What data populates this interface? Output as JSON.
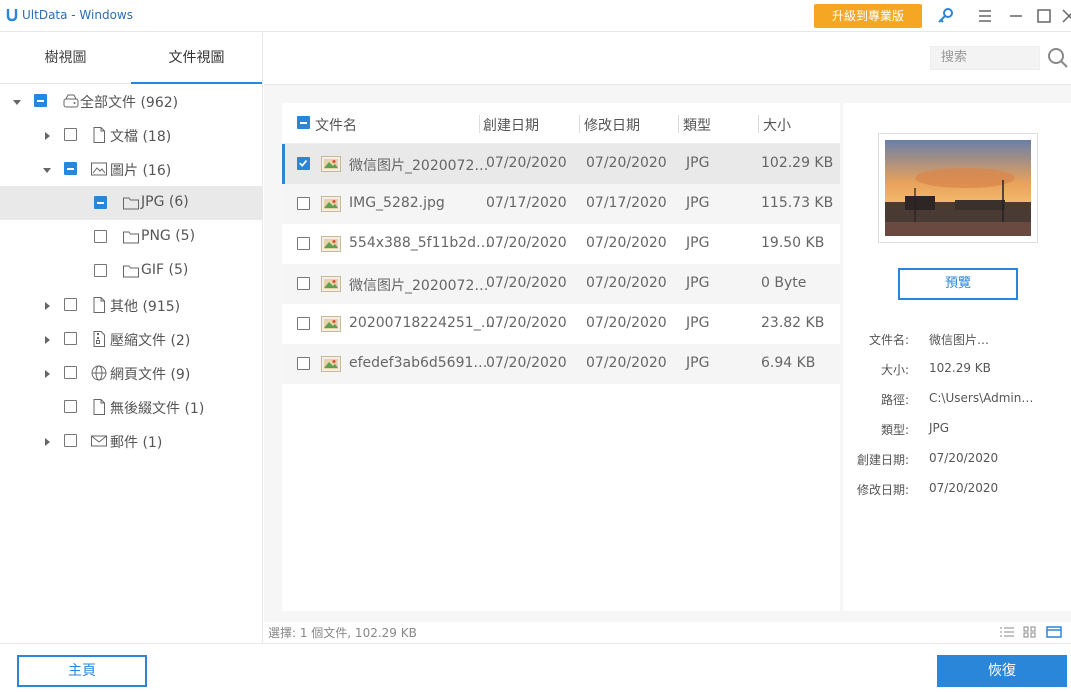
{
  "window": {
    "title": "UltData - Windows",
    "upgrade_label": "升級到專業版"
  },
  "colors": {
    "accent": "#2a86d8",
    "upgrade": "#f5a623"
  },
  "tabs": [
    {
      "label": "樹視圖",
      "active": false
    },
    {
      "label": "文件視圖",
      "active": true
    }
  ],
  "tree": [
    {
      "label": "全部文件 (962)",
      "icon": "drive-icon",
      "state": "partial",
      "expand": "open"
    },
    {
      "label": "文檔 (18)",
      "icon": "document-icon",
      "state": "unchecked",
      "expand": "closed"
    },
    {
      "label": "圖片 (16)",
      "icon": "image-icon",
      "state": "partial",
      "expand": "open"
    },
    {
      "label": "JPG (6)",
      "icon": "folder-icon",
      "state": "partial",
      "expand": "none"
    },
    {
      "label": "PNG (5)",
      "icon": "folder-icon",
      "state": "unchecked",
      "expand": "none"
    },
    {
      "label": "GIF (5)",
      "icon": "folder-icon",
      "state": "unchecked",
      "expand": "none"
    },
    {
      "label": "其他 (915)",
      "icon": "document-icon",
      "state": "unchecked",
      "expand": "closed"
    },
    {
      "label": "壓縮文件 (2)",
      "icon": "archive-icon",
      "state": "unchecked",
      "expand": "closed"
    },
    {
      "label": "網頁文件 (9)",
      "icon": "globe-icon",
      "state": "unchecked",
      "expand": "closed"
    },
    {
      "label": "無後綴文件 (1)",
      "icon": "document-icon",
      "state": "unchecked",
      "expand": "none"
    },
    {
      "label": "郵件 (1)",
      "icon": "mail-icon",
      "state": "unchecked",
      "expand": "closed"
    }
  ],
  "search": {
    "placeholder": "搜索"
  },
  "list": {
    "headers": {
      "name": "文件名",
      "created": "創建日期",
      "modified": "修改日期",
      "type": "類型",
      "size": "大小"
    },
    "rows": [
      {
        "name": "微信图片_2020072…",
        "created": "07/20/2020",
        "modified": "07/20/2020",
        "type": "JPG",
        "size": "102.29 KB",
        "checked": true
      },
      {
        "name": "IMG_5282.jpg",
        "created": "07/17/2020",
        "modified": "07/17/2020",
        "type": "JPG",
        "size": "115.73 KB",
        "checked": false
      },
      {
        "name": "554x388_5f11b2d…",
        "created": "07/20/2020",
        "modified": "07/20/2020",
        "type": "JPG",
        "size": "19.50 KB",
        "checked": false
      },
      {
        "name": "微信图片_2020072…",
        "created": "07/20/2020",
        "modified": "07/20/2020",
        "type": "JPG",
        "size": "0 Byte",
        "checked": false
      },
      {
        "name": "20200718224251_…",
        "created": "07/20/2020",
        "modified": "07/20/2020",
        "type": "JPG",
        "size": "23.82 KB",
        "checked": false
      },
      {
        "name": "efedef3ab6d5691…",
        "created": "07/20/2020",
        "modified": "07/20/2020",
        "type": "JPG",
        "size": "6.94 KB",
        "checked": false
      }
    ]
  },
  "details": {
    "preview_label": "預覽",
    "fields": [
      {
        "key": "文件名:",
        "value": "微信图片…"
      },
      {
        "key": "大小:",
        "value": "102.29 KB"
      },
      {
        "key": "路徑:",
        "value": "C:\\Users\\Admin…"
      },
      {
        "key": "類型:",
        "value": "JPG"
      },
      {
        "key": "創建日期:",
        "value": "07/20/2020"
      },
      {
        "key": "修改日期:",
        "value": "07/20/2020"
      }
    ]
  },
  "status": {
    "text": "選擇: 1 個文件, 102.29 KB"
  },
  "bottom": {
    "home_label": "主頁",
    "recover_label": "恢復"
  }
}
